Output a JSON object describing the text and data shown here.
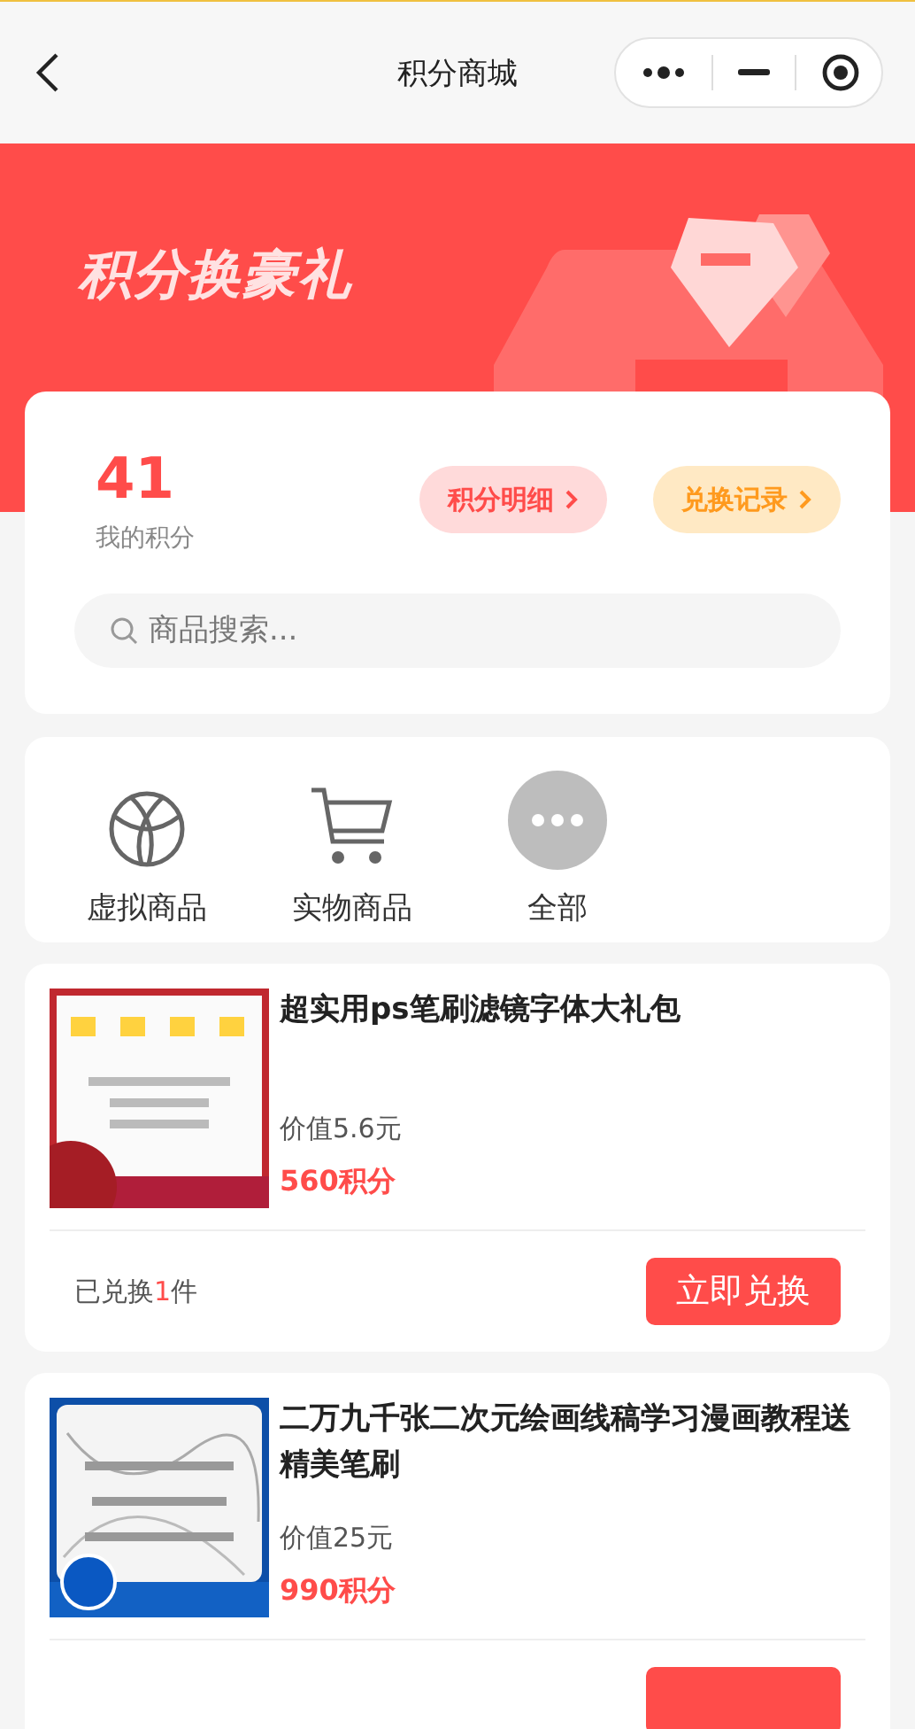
{
  "nav": {
    "title": "积分商城"
  },
  "banner": {
    "title": "积分换豪礼"
  },
  "points": {
    "value": "41",
    "label": "我的积分",
    "detail_button": "积分明细",
    "record_button": "兑换记录",
    "search_placeholder": "商品搜索..."
  },
  "categories": [
    {
      "kind": "globe",
      "label": "虚拟商品"
    },
    {
      "kind": "cart",
      "label": "实物商品"
    },
    {
      "kind": "more",
      "label": "全部"
    }
  ],
  "products": [
    {
      "title": "超实用ps笔刷滤镜字体大礼包",
      "value": "价值5.6元",
      "points": "560积分",
      "exchanged_prefix": "已兑换",
      "exchanged_count": "1",
      "exchanged_suffix": "件",
      "button": "立即兑换"
    },
    {
      "title": "二万九千张二次元绘画线稿学习漫画教程送精美笔刷",
      "value": "价值25元",
      "points": "990积分",
      "button_cut": true
    }
  ]
}
